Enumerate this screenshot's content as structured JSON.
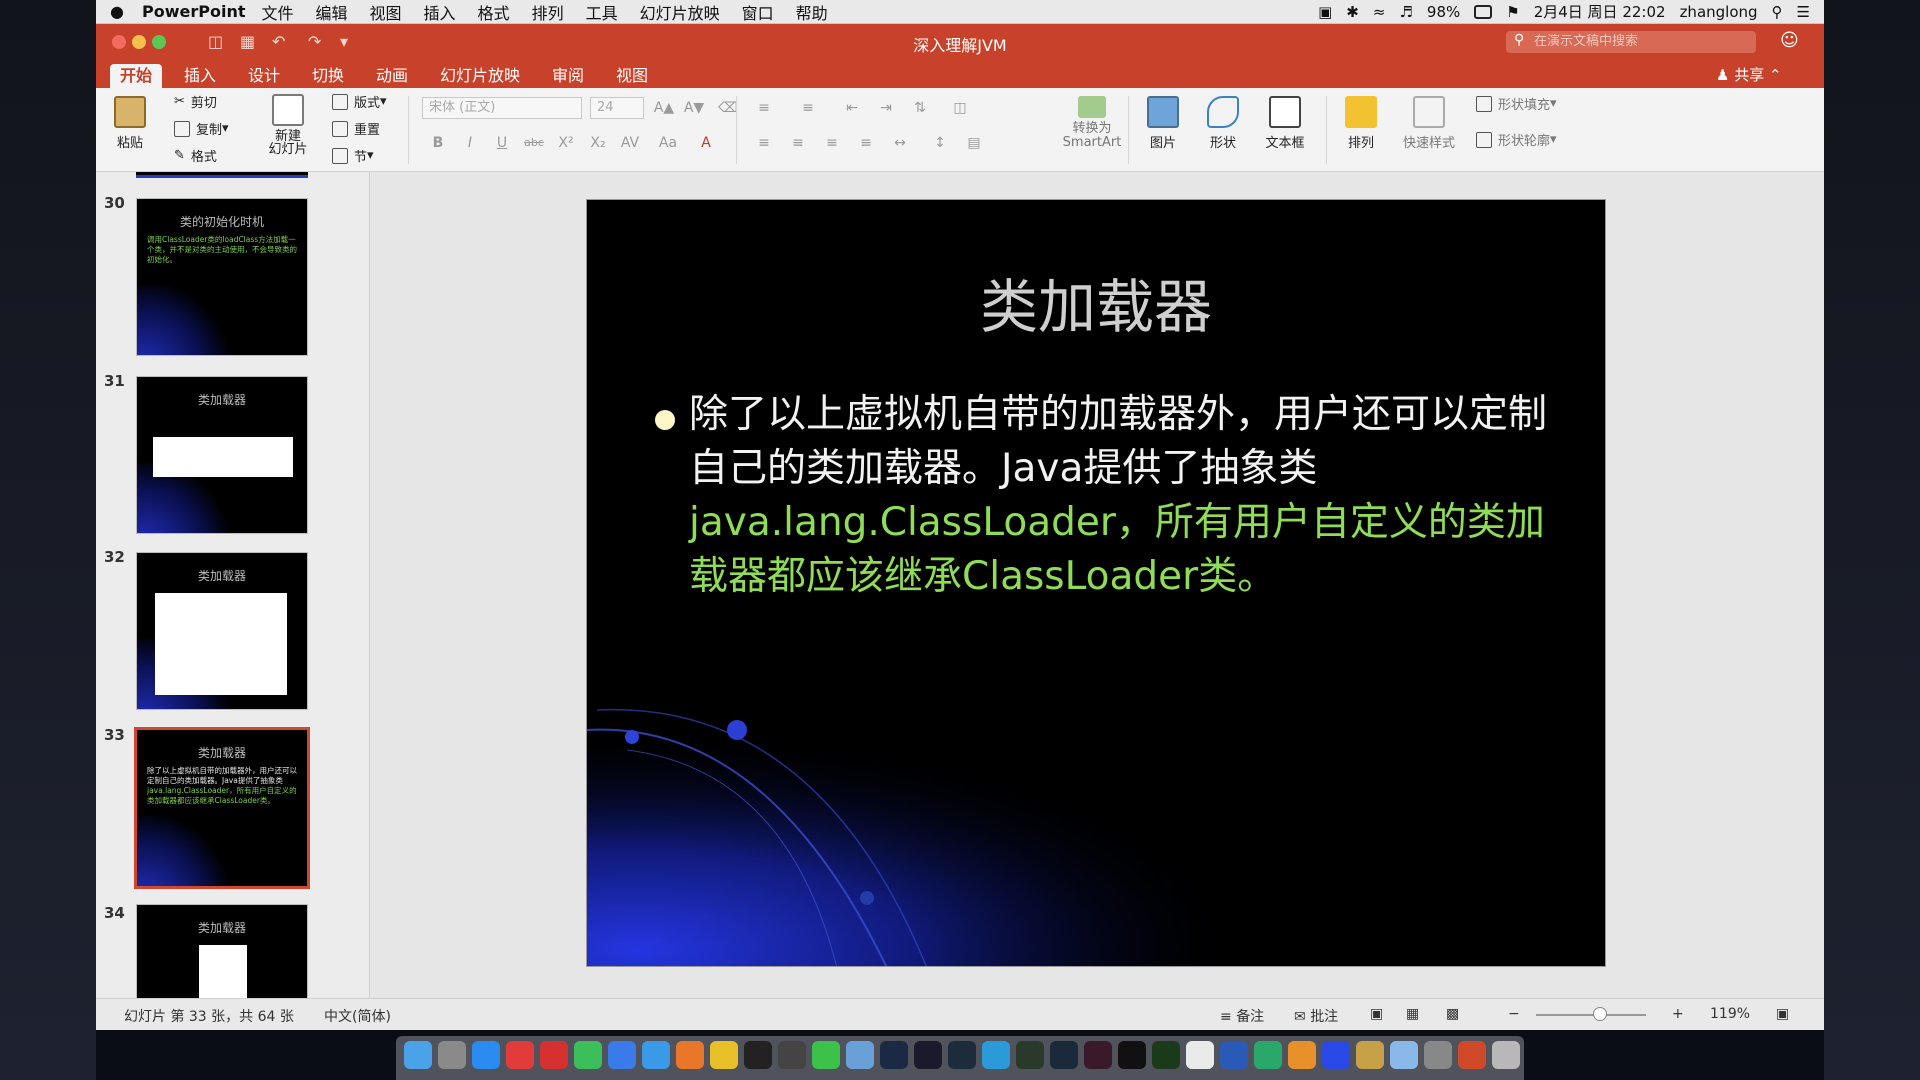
{
  "menubar": {
    "app_name": "PowerPoint",
    "items": [
      "文件",
      "编辑",
      "视图",
      "插入",
      "格式",
      "排列",
      "工具",
      "幻灯片放映",
      "窗口",
      "帮助"
    ],
    "battery": "98%",
    "datetime": "2月4日 周日 22:02",
    "user": "zhanglong"
  },
  "titlebar": {
    "document_title": "深入理解JVM",
    "search_placeholder": "在演示文稿中搜索"
  },
  "tabs": [
    "开始",
    "插入",
    "设计",
    "切换",
    "动画",
    "幻灯片放映",
    "审阅",
    "视图"
  ],
  "active_tab": "开始",
  "share_label": "共享",
  "ribbon": {
    "paste": "粘贴",
    "cut": "剪切",
    "copy": "复制",
    "format": "格式",
    "new_slide": "新建\n幻灯片",
    "layout": "版式",
    "reset": "重置",
    "section": "节",
    "font_name": "宋体 (正文)",
    "font_size": "24",
    "convert_smartart": "转换为\nSmartArt",
    "picture": "图片",
    "shape": "形状",
    "textbox": "文本框",
    "arrange": "排列",
    "quick_styles": "快速样式",
    "shape_fill": "形状填充",
    "shape_outline": "形状轮廓"
  },
  "thumbnails": [
    {
      "num": "30",
      "title": "类的初始化时机",
      "text": "调用ClassLoader类的loadClass方法加载一个类，并不是对类的主动使用，不会导致类的初始化。"
    },
    {
      "num": "31",
      "title": "类加载器"
    },
    {
      "num": "32",
      "title": "类加载器"
    },
    {
      "num": "33",
      "title": "类加载器",
      "text_a": "除了以上虚拟机自带的加载器外，用户还可以定制自己的类加载器。Java提供了抽象类",
      "text_b": "java.lang.ClassLoader，所有用户自定义的类加载器都应该继承ClassLoader类。"
    },
    {
      "num": "34",
      "title": "类加载器"
    }
  ],
  "slide": {
    "title": "类加载器",
    "body_white": "除了以上虚拟机自带的加载器外，用户还可以定制自己的类加载器。Java提供了抽象类",
    "body_green": "java.lang.ClassLoader，所有用户自定义的类加载器都应该继承ClassLoader类。"
  },
  "statusbar": {
    "slide_info": "幻灯片 第 33 张，共 64 张",
    "language": "中文(简体)",
    "notes": "备注",
    "comments": "批注",
    "zoom": "119%"
  },
  "colors": {
    "accent": "#c8412a",
    "slide_bg": "#000000",
    "slide_green": "#8fdc56"
  }
}
